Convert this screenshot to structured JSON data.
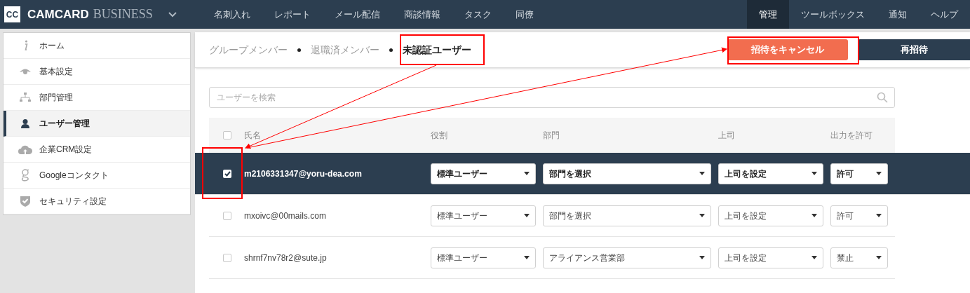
{
  "brand": {
    "logo": "CC",
    "name": "CAMCARD",
    "suffix": "BUSINESS"
  },
  "nav": [
    {
      "label": "名刺入れ",
      "selected": false
    },
    {
      "label": "レポート",
      "selected": false
    },
    {
      "label": "メール配信",
      "selected": false
    },
    {
      "label": "商談情報",
      "selected": false
    },
    {
      "label": "タスク",
      "selected": false
    },
    {
      "label": "同僚",
      "selected": false
    },
    {
      "label": "管理",
      "selected": true
    },
    {
      "label": "ツールボックス",
      "selected": false
    },
    {
      "label": "通知",
      "selected": false
    },
    {
      "label": "ヘルプ",
      "selected": false
    }
  ],
  "sidebar": {
    "items": [
      {
        "kind": "info",
        "label": "ホーム",
        "selected": false
      },
      {
        "kind": "eye",
        "label": "基本設定",
        "selected": false
      },
      {
        "kind": "org",
        "label": "部門管理",
        "selected": false
      },
      {
        "kind": "user",
        "label": "ユーザー管理",
        "selected": true
      },
      {
        "kind": "cloud",
        "label": "企業CRM設定",
        "selected": false
      },
      {
        "kind": "google",
        "label": "Googleコンタクト",
        "selected": false
      },
      {
        "kind": "shield",
        "label": "セキュリティ設定",
        "selected": false
      }
    ]
  },
  "tabs": [
    {
      "label": "グループメンバー",
      "selected": false
    },
    {
      "label": "退職済メンバー",
      "selected": false
    },
    {
      "label": "未認証ユーザー",
      "selected": true
    }
  ],
  "buttons": [
    {
      "kind": "primary",
      "label": "招待をキャンセル"
    },
    {
      "kind": "dark",
      "label": "再招待"
    }
  ],
  "search": {
    "placeholder": "ユーザーを検索"
  },
  "table": {
    "header_checked": false,
    "columns": [
      "氏名",
      "役割",
      "部門",
      "上司",
      "出力を許可"
    ],
    "rows": [
      {
        "selected": true,
        "checked": true,
        "email": "m2106331347@yoru-dea.com",
        "role": "標準ユーザー",
        "department": "部門を選択",
        "manager": "上司を設定",
        "output": "許可"
      },
      {
        "selected": false,
        "checked": false,
        "email": "mxoivc@00mails.com",
        "role": "標準ユーザー",
        "department": "部門を選択",
        "manager": "上司を設定",
        "output": "許可"
      },
      {
        "selected": false,
        "checked": false,
        "email": "shrnf7nv78r2@sute.jp",
        "role": "標準ユーザー",
        "department": "アライアンス営業部",
        "manager": "上司を設定",
        "output": "禁止"
      }
    ]
  }
}
